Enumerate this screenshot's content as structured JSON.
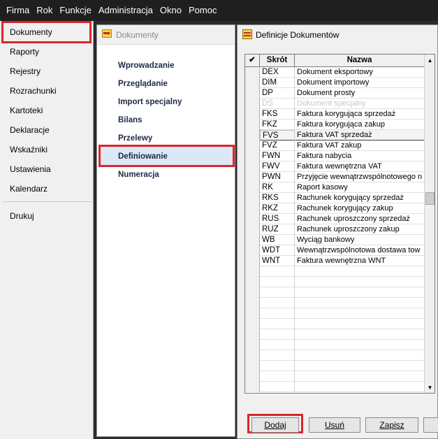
{
  "menu": [
    "Firma",
    "Rok",
    "Funkcje",
    "Administracja",
    "Okno",
    "Pomoc"
  ],
  "nav": {
    "items": [
      "Dokumenty",
      "Raporty",
      "Rejestry",
      "Rozrachunki",
      "Kartoteki",
      "Deklaracje",
      "Wskaźniki",
      "Ustawienia",
      "Kalendarz"
    ],
    "print": "Drukuj"
  },
  "subpanel": {
    "title": "Dokumenty",
    "items": [
      "Wprowadzanie",
      "Przeglądanie",
      "Import specjalny",
      "Bilans",
      "Przelewy",
      "Definiowanie",
      "Numeracja"
    ]
  },
  "window": {
    "title": "Definicje Dokumentów",
    "columns": {
      "check": "✔",
      "skrot": "Skrót",
      "nazwa": "Nazwa"
    },
    "rows": [
      [
        "DEX",
        "Dokument eksportowy"
      ],
      [
        "DIM",
        "Dokument importowy"
      ],
      [
        "DP",
        "Dokument prosty"
      ],
      [
        "DS",
        "Dokument specjalny"
      ],
      [
        "FKS",
        "Faktura korygująca sprzedaż"
      ],
      [
        "FKZ",
        "Faktura korygująca zakup"
      ],
      [
        "FVS",
        "Faktura VAT sprzedaż"
      ],
      [
        "FVZ",
        "Faktura VAT zakup"
      ],
      [
        "FWN",
        "Faktura nabycia"
      ],
      [
        "FWV",
        "Faktura wewnętrzna VAT"
      ],
      [
        "PWN",
        "Przyjęcie wewnątrzwspólnotowego n"
      ],
      [
        "RK",
        "Raport kasowy"
      ],
      [
        "RKS",
        "Rachunek korygujący sprzedaż"
      ],
      [
        "RKZ",
        "Rachunek korygujący zakup"
      ],
      [
        "RUS",
        "Rachunek uproszczony sprzedaż"
      ],
      [
        "RUZ",
        "Rachunek uproszczony zakup"
      ],
      [
        "WB",
        "Wyciąg bankowy"
      ],
      [
        "WDT",
        "Wewnątrzwspólnotowa dostawa tow"
      ],
      [
        "WNT",
        "Faktura wewnętrzna WNT"
      ]
    ],
    "buttons": {
      "add": "Dodaj",
      "delete": "Usuń",
      "save": "Zapisz"
    }
  },
  "colors": {
    "highlight": "#d9262c",
    "menubar": "#1f1f1f",
    "selection_accent": "#2c5fb8"
  }
}
